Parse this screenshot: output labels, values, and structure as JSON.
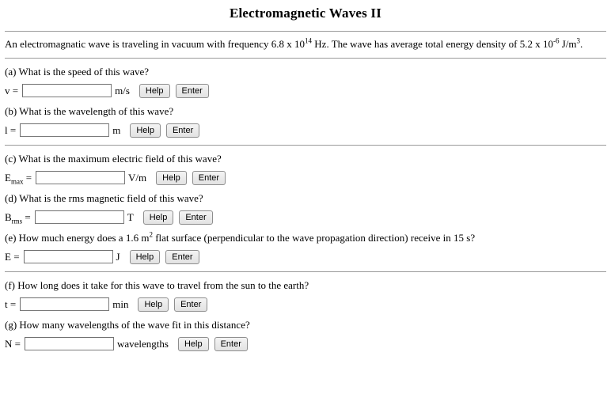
{
  "page": {
    "title": "Electromagnetic Waves II",
    "intro": {
      "part1": "An electromagnatic wave is traveling in vacuum with frequency 6.8 x 10",
      "exp1": "14",
      "part2": " Hz. The wave has average total energy density of 5.2 x 10",
      "exp2": "-6",
      "part3": " J/m",
      "exp3": "3",
      "part4": "."
    },
    "buttons": {
      "help_label": "Help",
      "enter_label": "Enter"
    },
    "input_value": "",
    "input_placeholder": "",
    "questions": [
      {
        "id": "a",
        "text": "(a) What is the speed of this wave?",
        "var": "v",
        "var_sub": "",
        "equals": "=",
        "unit": "m/s"
      },
      {
        "id": "b",
        "text": "(b) What is the wavelength of this wave?",
        "var": "l",
        "var_sub": "",
        "equals": "=",
        "unit": "m"
      },
      {
        "id": "c",
        "text": "(c) What is the maximum electric field of this wave?",
        "var": "E",
        "var_sub": "max",
        "equals": "=",
        "unit": "V/m"
      },
      {
        "id": "d",
        "text": "(d) What is the rms magnetic field of this wave?",
        "var": "B",
        "var_sub": "rms",
        "equals": "=",
        "unit": "T"
      },
      {
        "id": "e",
        "text_part1": "(e) How much energy does a 1.6 m",
        "text_exp": "2",
        "text_part2": " flat surface (perpendicular to the wave propagation direction) receive in 15 s?",
        "var": "E",
        "var_sub": "",
        "equals": "=",
        "unit": "J"
      },
      {
        "id": "f",
        "text": "(f) How long does it take for this wave to travel from the sun to the earth?",
        "var": "t",
        "var_sub": "",
        "equals": "=",
        "unit": "min"
      },
      {
        "id": "g",
        "text": "(g) How many wavelengths of the wave fit in this distance?",
        "var": "N",
        "var_sub": "",
        "equals": "=",
        "unit": "wavelengths"
      }
    ]
  }
}
